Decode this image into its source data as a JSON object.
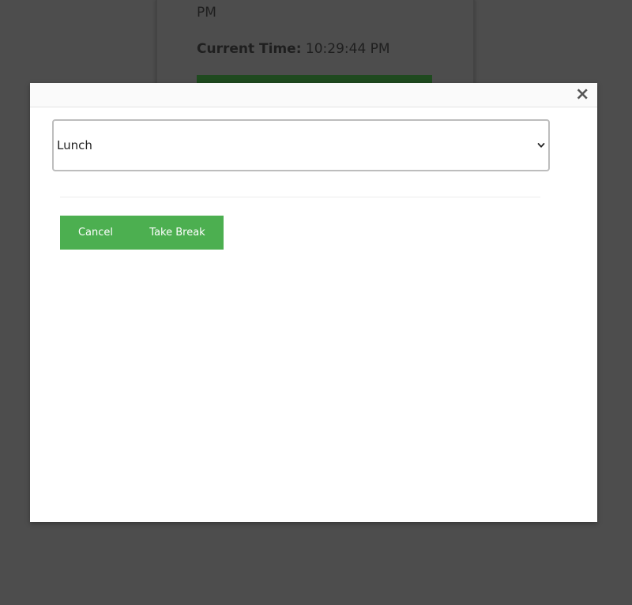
{
  "background": {
    "pm_text": "PM",
    "current_time_label": "Current Time:",
    "current_time_value": "10:29:44 PM"
  },
  "modal": {
    "close_icon": "close-icon",
    "break_select": {
      "selected": "Lunch",
      "icon": "chevron-down-icon"
    },
    "buttons": {
      "cancel_label": "Cancel",
      "take_break_label": "Take Break"
    }
  },
  "colors": {
    "overlay": "#4d4d4d",
    "button_green": "#4caf50",
    "bg_bar_green": "#1f4a1f"
  }
}
